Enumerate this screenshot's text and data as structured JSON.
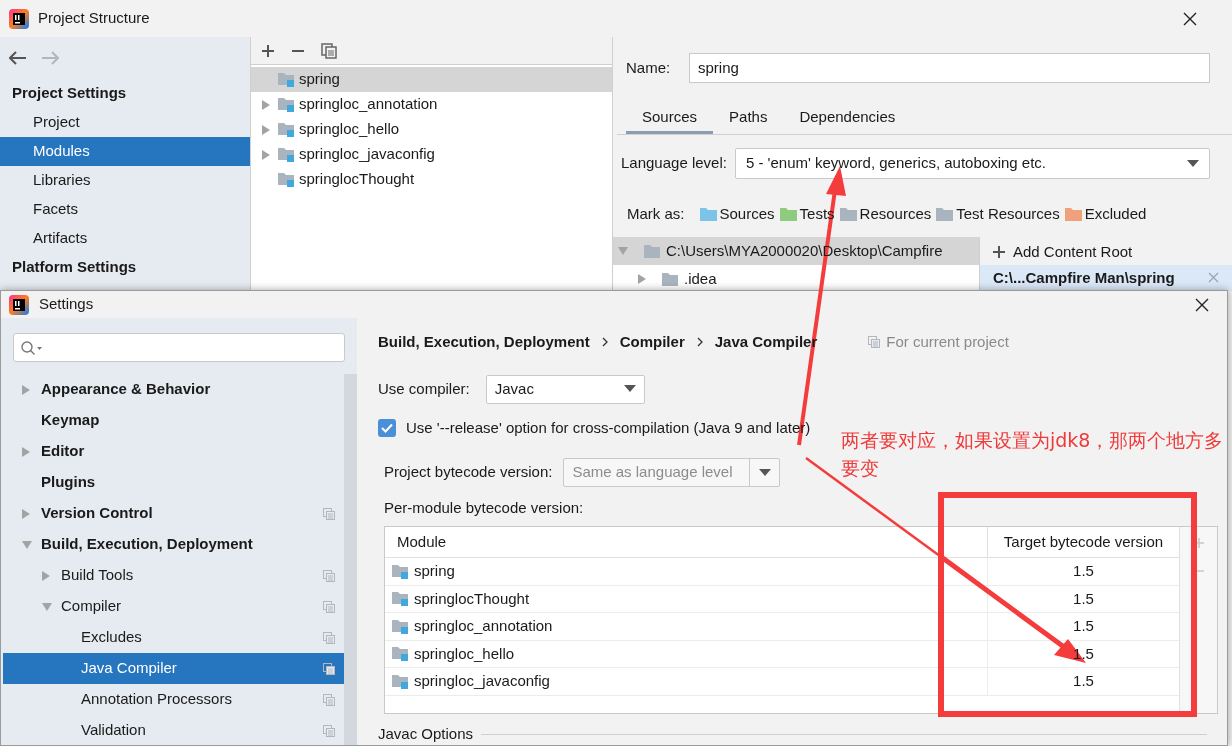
{
  "project_structure": {
    "title": "Project Structure",
    "sidebar": [
      {
        "heading": "Project Settings",
        "items": [
          {
            "label": "Project",
            "selected": false
          },
          {
            "label": "Modules",
            "selected": true
          },
          {
            "label": "Libraries",
            "selected": false
          },
          {
            "label": "Facets",
            "selected": false
          },
          {
            "label": "Artifacts",
            "selected": false
          }
        ]
      },
      {
        "heading": "Platform Settings"
      }
    ],
    "modules": [
      {
        "name": "spring",
        "selected": true
      },
      {
        "name": "springloc_annotation",
        "expanded": false,
        "selected": false
      },
      {
        "name": "springloc_hello",
        "expanded": false,
        "selected": false
      },
      {
        "name": "springloc_javaconfig",
        "expanded": false,
        "selected": false
      },
      {
        "name": "springlocThought",
        "selected": false
      }
    ],
    "name_label": "Name:",
    "name_value": "spring",
    "tabs": [
      {
        "label": "Sources",
        "selected": true
      },
      {
        "label": "Paths",
        "selected": false
      },
      {
        "label": "Dependencies",
        "selected": false
      }
    ],
    "language_level": {
      "label": "Language level:",
      "value": "5 - 'enum' keyword, generics, autoboxing etc."
    },
    "mark_as": {
      "label": "Mark as:",
      "items": [
        {
          "label": "Sources",
          "color": "#7cc3e8"
        },
        {
          "label": "Tests",
          "color": "#8fcb7e"
        },
        {
          "label": "Resources",
          "color": "#a9b4bf"
        },
        {
          "label": "Test Resources",
          "color": "#a9b4bf"
        },
        {
          "label": "Excluded",
          "color": "#f0a07a"
        }
      ]
    },
    "content_tree": [
      {
        "label": "C:\\Users\\MYA2000020\\Desktop\\Campfire",
        "expanded": true,
        "children": [
          {
            "label": ".idea",
            "expanded": false
          }
        ]
      }
    ],
    "add_content_root": "Add Content Root",
    "content_root": "C:\\...Campfire Man\\spring"
  },
  "settings": {
    "title": "Settings",
    "tree": [
      {
        "label": "Appearance & Behavior",
        "expanded": false,
        "project_level": false,
        "selected": false
      },
      {
        "label": "Keymap",
        "project_level": false,
        "selected": false
      },
      {
        "label": "Editor",
        "expanded": false,
        "project_level": false,
        "selected": false
      },
      {
        "label": "Plugins",
        "project_level": false,
        "selected": false
      },
      {
        "label": "Version Control",
        "expanded": false,
        "project_level": true,
        "selected": false
      },
      {
        "label": "Build, Execution, Deployment",
        "expanded": true,
        "project_level": false,
        "selected": false,
        "children": [
          {
            "label": "Build Tools",
            "expanded": false,
            "project_level": true,
            "selected": false
          },
          {
            "label": "Compiler",
            "expanded": true,
            "project_level": true,
            "selected": false,
            "children": [
              {
                "label": "Excludes",
                "project_level": true,
                "selected": false
              },
              {
                "label": "Java Compiler",
                "project_level": true,
                "selected": true
              },
              {
                "label": "Annotation Processors",
                "project_level": true,
                "selected": false
              },
              {
                "label": "Validation",
                "project_level": true,
                "selected": false
              }
            ]
          }
        ]
      }
    ],
    "breadcrumb": [
      "Build, Execution, Deployment",
      "Compiler",
      "Java Compiler"
    ],
    "scope": "For current project",
    "use_compiler": {
      "label": "Use compiler:",
      "value": "Javac"
    },
    "release_option": {
      "label": "Use '--release' option for cross-compilation (Java 9 and later)",
      "checked": true
    },
    "project_bytecode": {
      "label": "Project bytecode version:",
      "value": "Same as language level",
      "disabled": true
    },
    "per_module_label": "Per-module bytecode version:",
    "table": {
      "columns": [
        "Module",
        "Target bytecode version"
      ],
      "rows": [
        {
          "module": "spring",
          "version": "1.5"
        },
        {
          "module": "springlocThought",
          "version": "1.5"
        },
        {
          "module": "springloc_annotation",
          "version": "1.5"
        },
        {
          "module": "springloc_hello",
          "version": "1.5"
        },
        {
          "module": "springloc_javaconfig",
          "version": "1.5"
        }
      ]
    },
    "javac_options": "Javac Options"
  },
  "annotation": {
    "note": "两者要对应，如果设置为jdk8，那两个地方多要变"
  }
}
